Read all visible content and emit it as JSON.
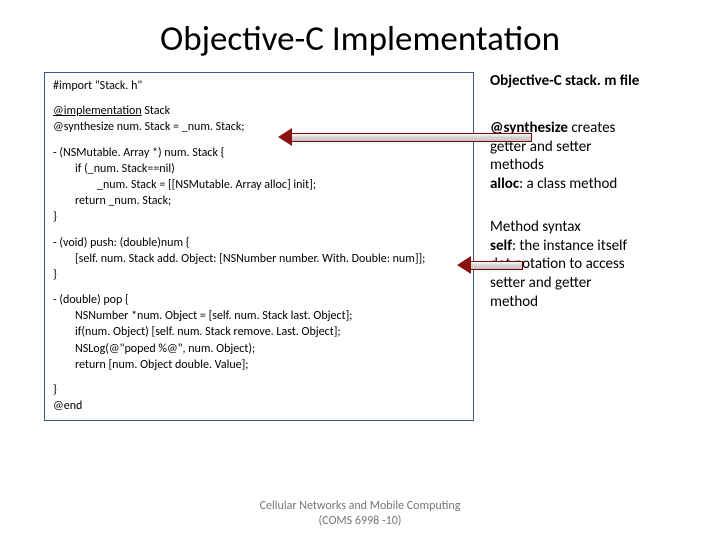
{
  "title": "Objective-C Implementation",
  "code": {
    "l1": "#import \"Stack. h\"",
    "l2a": "@implementation",
    "l2b": " Stack",
    "l3": "@synthesize num. Stack = _num. Stack;",
    "l4": "- (NSMutable. Array *) num. Stack {",
    "l5": "if (_num. Stack==nil)",
    "l6": "_num. Stack = [[NSMutable. Array alloc] init];",
    "l7": "return _num. Stack;",
    "l8": "}",
    "l9": "- (void) push: (double)num {",
    "l10": "[self. num. Stack add. Object: [NSNumber number. With. Double: num]];",
    "l11": "}",
    "l12": "- (double) pop {",
    "l13": "NSNumber *num. Object = [self. num. Stack last. Object];",
    "l14": "if(num. Object) [self. num. Stack remove. Last. Object];",
    "l15": "NSLog(@\"poped %@\", num. Object);",
    "l16": "return [num. Object double. Value];",
    "l17": "}",
    "l18": "@end"
  },
  "side": {
    "top": "Objective-C stack. m file",
    "b1l1a": "@synthesize ",
    "b1l1b": "creates",
    "b1l2": "getter and setter",
    "b1l3": "methods",
    "b1l4a": "alloc",
    "b1l4b": ": a class method",
    "b2l1": "Method syntax",
    "b2l2a": "self",
    "b2l2b": ": the instance itself",
    "b2l3": "dot notation to access",
    "b2l4": "setter and getter",
    "b2l5": "method"
  },
  "footer": {
    "l1": "Cellular Networks and Mobile Computing",
    "l2": "(COMS 6998 -10)"
  }
}
